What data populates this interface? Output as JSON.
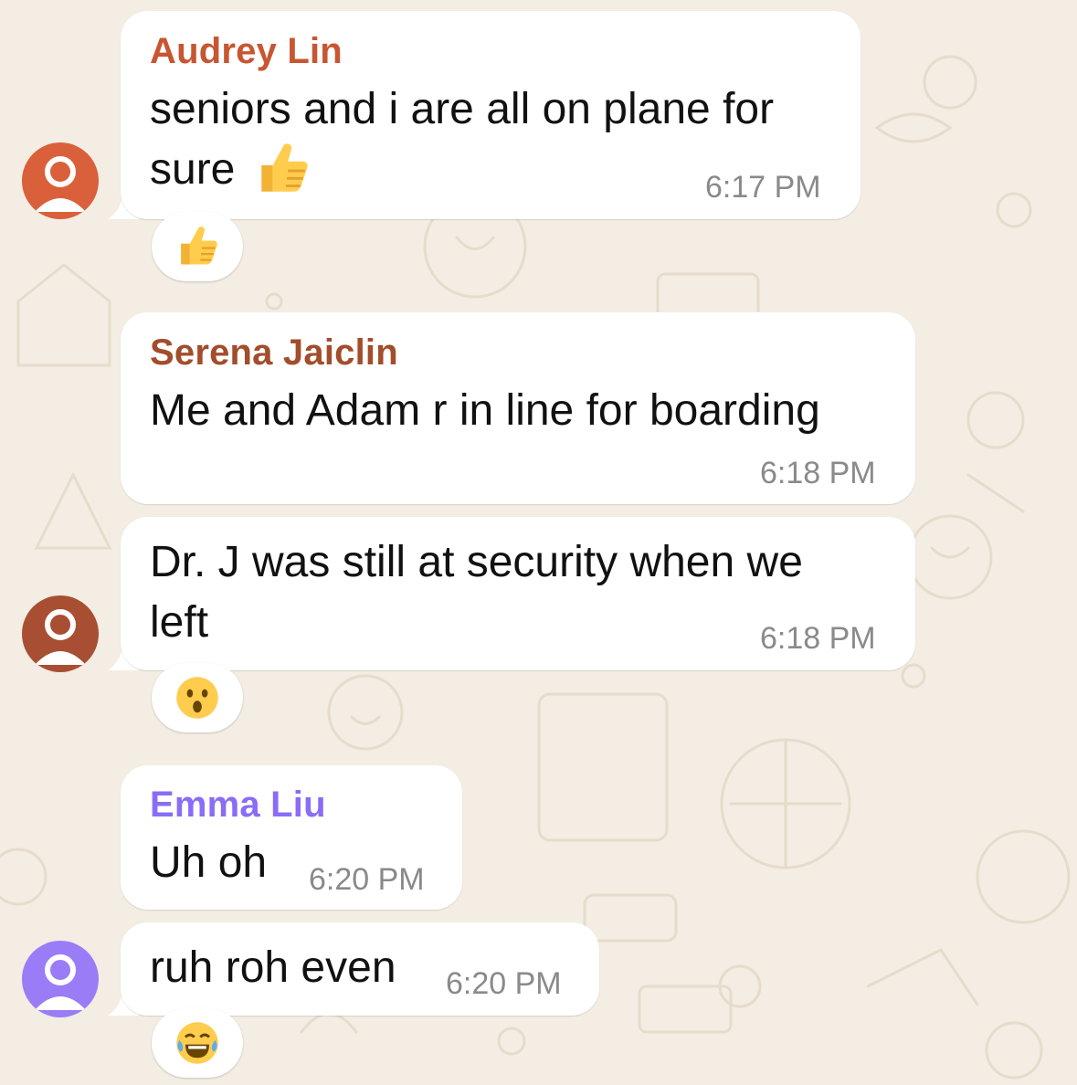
{
  "messages": [
    {
      "sender": "Audrey Lin",
      "sender_color": "#c75631",
      "lines": [
        "seniors and i are all on plane for",
        "sure"
      ],
      "inline_emoji": "thumbs-up",
      "time": "6:17 PM",
      "reaction": "thumbs-up",
      "avatar_color": "#d9603a"
    },
    {
      "sender": "Serena Jaiclin",
      "sender_color": "#a24d2b",
      "lines": [
        "Me and Adam r in line for boarding"
      ],
      "time": "6:18 PM"
    },
    {
      "lines": [
        "Dr. J was still at security when we",
        "left"
      ],
      "time": "6:18 PM",
      "reaction": "astonished-face",
      "avatar_color": "#a84f33"
    },
    {
      "sender": "Emma Liu",
      "sender_color": "#8a6cf5",
      "lines": [
        "Uh oh"
      ],
      "time": "6:20 PM"
    },
    {
      "lines": [
        "ruh roh even"
      ],
      "time": "6:20 PM",
      "reaction": "tears-of-joy-face",
      "avatar_color": "#9a7cf7"
    }
  ]
}
